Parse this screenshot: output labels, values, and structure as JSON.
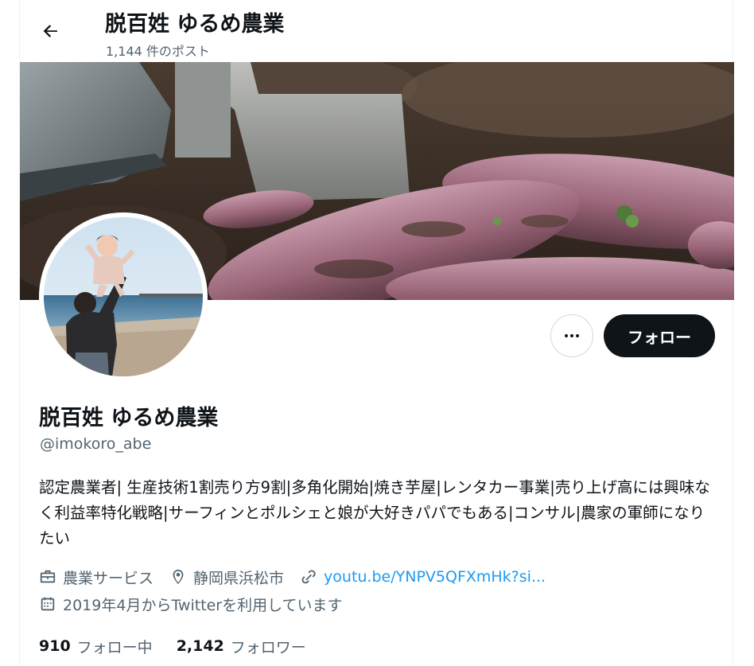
{
  "header": {
    "title": "脱百姓 ゆるめ農業",
    "post_count": "1,144 件のポスト"
  },
  "profile": {
    "name": "脱百姓 ゆるめ農業",
    "handle": "@imokoro_abe",
    "bio": "認定農業者| 生産技術1割売り方9割|多角化開始|焼き芋屋|レンタカー事業|売り上げ高には興味なく利益率特化戦略|サーフィンとポルシェと娘が大好きパパでもある|コンサル|農家の軍師になりたい",
    "category": "農業サービス",
    "location": "静岡県浜松市",
    "link": "youtu.be/YNPV5QFXmHk?si...",
    "joined": "2019年4月からTwitterを利用しています",
    "following_count": "910",
    "following_label": "フォロー中",
    "followers_count": "2,142",
    "followers_label": "フォロワー"
  },
  "actions": {
    "follow_label": "フォロー"
  },
  "colors": {
    "text": "#0f1419",
    "secondary": "#536471",
    "link": "#1d9bf0",
    "button_dark": "#0f1419"
  },
  "icons": [
    "back-arrow-icon",
    "more-icon",
    "briefcase-icon",
    "location-pin-icon",
    "link-icon",
    "calendar-icon"
  ]
}
